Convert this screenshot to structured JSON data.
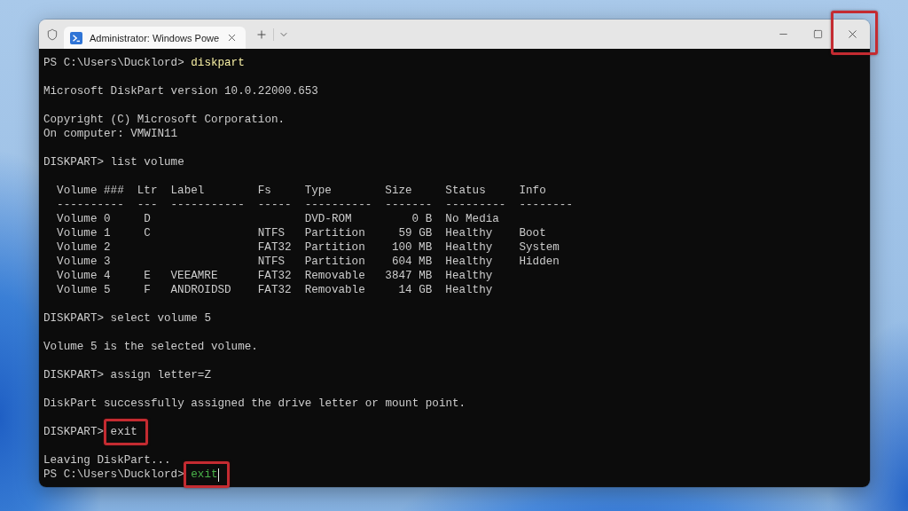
{
  "title_bar": {
    "tab": {
      "title": "Administrator: Windows Powe",
      "selected": true
    },
    "controls": [
      {
        "kind": "minimize",
        "highlighted": false
      },
      {
        "kind": "maximize",
        "highlighted": false
      },
      {
        "kind": "close",
        "highlighted": true
      }
    ]
  },
  "terminal": {
    "blocks": [
      {
        "kind": "lines",
        "lines": [
          {
            "kind": "prompt",
            "prompt": "PS C:\\Users\\Ducklord>",
            "command": "diskpart",
            "color": "#f9f1a5",
            "highlighted": false,
            "cursor": false
          }
        ]
      },
      {
        "kind": "lines",
        "lines": [
          {
            "kind": "output",
            "text": "Microsoft DiskPart version 10.0.22000.653"
          }
        ]
      },
      {
        "kind": "lines",
        "lines": [
          {
            "kind": "output",
            "text": "Copyright (C) Microsoft Corporation."
          },
          {
            "kind": "output",
            "text": "On computer: VMWIN11"
          }
        ]
      },
      {
        "kind": "lines",
        "lines": [
          {
            "kind": "prompt",
            "prompt": "DISKPART>",
            "command": "list volume",
            "color": "#cccccc",
            "highlighted": false,
            "cursor": false
          }
        ]
      },
      {
        "kind": "table",
        "header": {
          "volume": "Volume ###",
          "ltr": "Ltr",
          "label": "Label",
          "fs": "Fs",
          "type": "Type",
          "size": "Size",
          "status": "Status",
          "info": "Info"
        },
        "rules": {
          "volume": "----------",
          "ltr": "---",
          "label": "-----------",
          "fs": "-----",
          "type": "----------",
          "size": "-------",
          "status": "---------",
          "info": "--------"
        },
        "rows": [
          {
            "volume": "Volume 0",
            "ltr": "D",
            "type": "DVD-ROM",
            "size": "0 B",
            "status": "No Media"
          },
          {
            "volume": "Volume 1",
            "ltr": "C",
            "fs": "NTFS",
            "type": "Partition",
            "size": "59 GB",
            "status": "Healthy",
            "info": "Boot"
          },
          {
            "volume": "Volume 2",
            "fs": "FAT32",
            "type": "Partition",
            "size": "100 MB",
            "status": "Healthy",
            "info": "System"
          },
          {
            "volume": "Volume 3",
            "fs": "NTFS",
            "type": "Partition",
            "size": "604 MB",
            "status": "Healthy",
            "info": "Hidden"
          },
          {
            "volume": "Volume 4",
            "ltr": "E",
            "label": "VEEAMRE",
            "fs": "FAT32",
            "type": "Removable",
            "size": "3847 MB",
            "status": "Healthy"
          },
          {
            "volume": "Volume 5",
            "ltr": "F",
            "label": "ANDROIDSD",
            "fs": "FAT32",
            "type": "Removable",
            "size": "14 GB",
            "status": "Healthy"
          }
        ]
      },
      {
        "kind": "lines",
        "lines": [
          {
            "kind": "prompt",
            "prompt": "DISKPART>",
            "command": "select volume 5",
            "color": "#cccccc",
            "highlighted": false,
            "cursor": false
          }
        ]
      },
      {
        "kind": "lines",
        "lines": [
          {
            "kind": "output",
            "text": "Volume 5 is the selected volume."
          }
        ]
      },
      {
        "kind": "lines",
        "lines": [
          {
            "kind": "prompt",
            "prompt": "DISKPART>",
            "command": "assign letter=Z",
            "color": "#cccccc",
            "highlighted": false,
            "cursor": false
          }
        ]
      },
      {
        "kind": "lines",
        "lines": [
          {
            "kind": "output",
            "text": "DiskPart successfully assigned the drive letter or mount point."
          }
        ]
      },
      {
        "kind": "lines",
        "lines": [
          {
            "kind": "prompt",
            "prompt": "DISKPART>",
            "command": "exit",
            "color": "#cccccc",
            "highlighted": true,
            "cursor": false
          }
        ]
      },
      {
        "kind": "lines",
        "lines": [
          {
            "kind": "output",
            "text": "Leaving DiskPart..."
          },
          {
            "kind": "prompt",
            "prompt": "PS C:\\Users\\Ducklord>",
            "command": "exit",
            "color": "#48b048",
            "highlighted": true,
            "cursor": true
          }
        ]
      }
    ]
  }
}
